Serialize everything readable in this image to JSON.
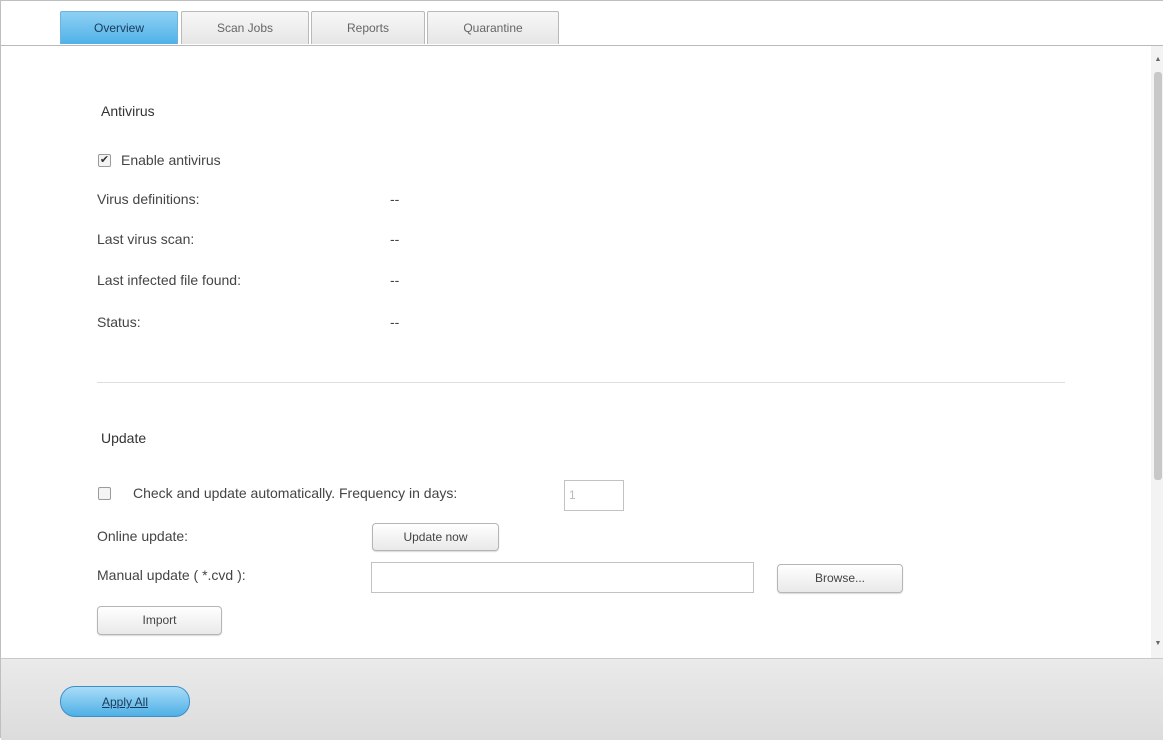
{
  "tabs": [
    {
      "label": "Overview",
      "active": true
    },
    {
      "label": "Scan Jobs",
      "active": false
    },
    {
      "label": "Reports",
      "active": false
    },
    {
      "label": "Quarantine",
      "active": false
    }
  ],
  "antivirus": {
    "title": "Antivirus",
    "enable_label": "Enable antivirus",
    "enable_checked": true,
    "rows": [
      {
        "label": "Virus definitions:",
        "value": "--"
      },
      {
        "label": "Last virus scan:",
        "value": "--"
      },
      {
        "label": "Last infected file found:",
        "value": "--"
      },
      {
        "label": "Status:",
        "value": "--"
      }
    ]
  },
  "update": {
    "title": "Update",
    "auto_label": "Check and update automatically. Frequency in days:",
    "auto_checked": false,
    "frequency_value": "1",
    "online_label": "Online update:",
    "update_now_label": "Update now",
    "manual_label": "Manual update ( *.cvd ):",
    "manual_value": "",
    "browse_label": "Browse...",
    "import_label": "Import"
  },
  "footer": {
    "apply_label": "Apply All"
  },
  "colors": {
    "accent": "#4fb2e8",
    "tab_active": "#8fd0f3"
  }
}
